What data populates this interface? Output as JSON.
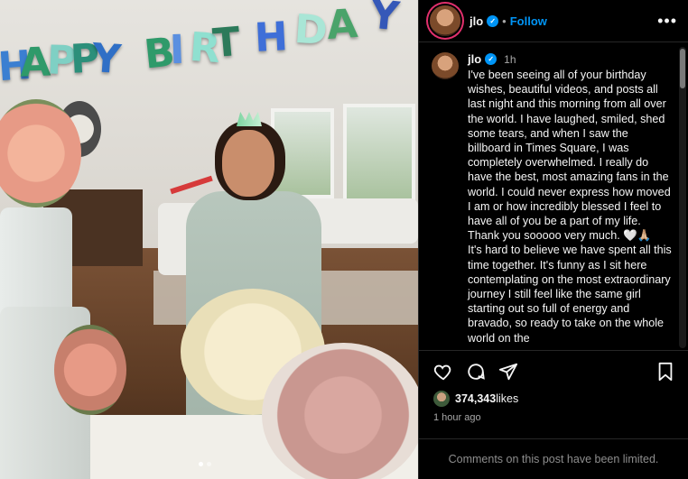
{
  "photo": {
    "balloon_letters": [
      {
        "char": "H",
        "color": "#3b7fd1"
      },
      {
        "char": "A",
        "color": "#2f9a6a"
      },
      {
        "char": "P",
        "color": "#7fd0c4"
      },
      {
        "char": "P",
        "color": "#2c8f7a"
      },
      {
        "char": "Y",
        "color": "#2f6fc6"
      },
      {
        "char": "B",
        "color": "#2f9a6a"
      },
      {
        "char": "I",
        "color": "#5a8fe0"
      },
      {
        "char": "R",
        "color": "#8fe0d0"
      },
      {
        "char": "T",
        "color": "#2c7a5a"
      },
      {
        "char": "H",
        "color": "#3f6fd8"
      },
      {
        "char": "D",
        "color": "#a9e6d6"
      },
      {
        "char": "A",
        "color": "#4aa36a"
      },
      {
        "char": "Y",
        "color": "#3558b8"
      }
    ],
    "carousel": {
      "count": 2,
      "active": 0
    }
  },
  "header": {
    "username": "jlo",
    "separator": "•",
    "follow_label": "Follow",
    "more_icon": "more-horizontal-icon"
  },
  "post": {
    "username": "jlo",
    "time": "1h",
    "caption": "I've been seeing all of your birthday wishes, beautiful videos, and posts all last night and this morning from all over the world. I have laughed, smiled, shed some tears, and when I saw the billboard in Times Square, I was completely overwhelmed. I really do have the best, most amazing fans in the world. I could never express how moved I am or how incredibly blessed I feel to have all of you be a part of my life. Thank you sooooo very much. 🤍🙏🏼\nIt's hard to believe we have spent all this time together. It's funny as I sit here contemplating on the most extraordinary journey I still feel like the same girl starting out so full of energy and bravado, so ready to take on the whole world on the"
  },
  "actions": {
    "icons": [
      "heart-icon",
      "comment-icon",
      "share-icon",
      "bookmark-icon"
    ]
  },
  "likes": {
    "count": "374,343",
    "suffix": " likes"
  },
  "timeago": "1 hour ago",
  "comments_notice": "Comments on this post have been limited.",
  "colors": {
    "accent": "#0095f6",
    "background": "#000000",
    "muted": "#a8a8a8"
  }
}
